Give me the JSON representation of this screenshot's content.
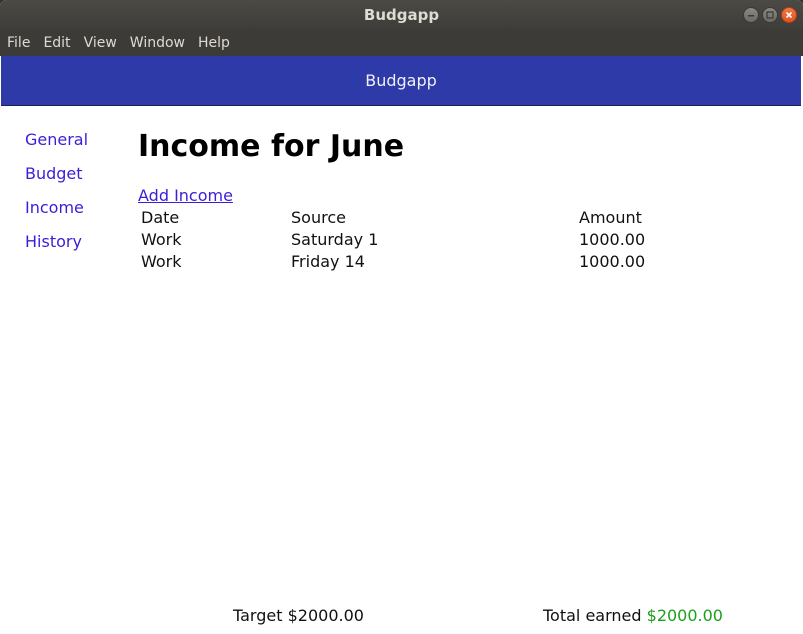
{
  "window": {
    "title": "Budgapp"
  },
  "menubar": {
    "items": [
      "File",
      "Edit",
      "View",
      "Window",
      "Help"
    ]
  },
  "header": {
    "title": "Budgapp"
  },
  "sidebar": {
    "items": [
      {
        "label": "General"
      },
      {
        "label": "Budget"
      },
      {
        "label": "Income"
      },
      {
        "label": "History"
      }
    ]
  },
  "main": {
    "title": "Income for June",
    "add_link": "Add Income",
    "table": {
      "headers": [
        "Date",
        "Source",
        "Amount"
      ],
      "rows": [
        [
          "Work",
          "Saturday 1",
          "1000.00"
        ],
        [
          "Work",
          "Friday 14",
          "1000.00"
        ]
      ]
    }
  },
  "footer": {
    "target_label": "Target",
    "target_value": "$2000.00",
    "earned_label": "Total earned",
    "earned_value": "$2000.00"
  },
  "colors": {
    "header_bg": "#2d3aa7",
    "link": "#3a1ed8",
    "earned_value": "#1aa11a"
  }
}
